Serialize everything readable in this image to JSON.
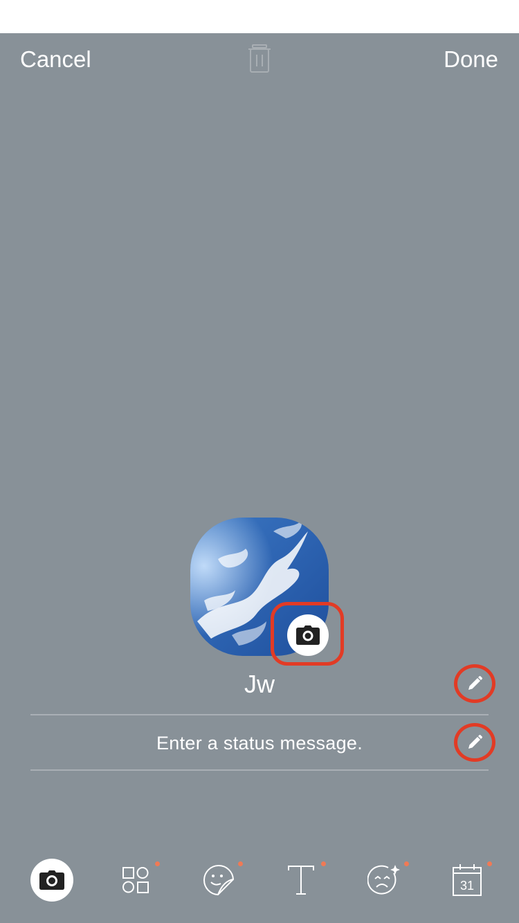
{
  "topbar": {
    "cancel_label": "Cancel",
    "done_label": "Done",
    "trash_icon": "trash-icon"
  },
  "profile": {
    "name": "Jw",
    "status_placeholder": "Enter a status message.",
    "avatar_description": "sky-with-clouds-photo"
  },
  "icons": {
    "camera_badge": "camera-icon",
    "edit_name": "pencil-icon",
    "edit_status": "pencil-icon"
  },
  "toolbar": {
    "items": [
      {
        "name": "camera",
        "icon": "camera-icon",
        "active": true,
        "has_dot": false
      },
      {
        "name": "shapes",
        "icon": "shapes-icon",
        "active": false,
        "has_dot": true
      },
      {
        "name": "sticker",
        "icon": "sticker-icon",
        "active": false,
        "has_dot": true
      },
      {
        "name": "text",
        "icon": "text-icon",
        "active": false,
        "has_dot": true
      },
      {
        "name": "effects",
        "icon": "sparkle-face-icon",
        "active": false,
        "has_dot": true
      },
      {
        "name": "calendar",
        "icon": "calendar-icon",
        "active": false,
        "has_dot": true,
        "label": "31"
      }
    ]
  },
  "colors": {
    "background": "#889198",
    "highlight": "#e23b25",
    "notification_dot": "#f07a55"
  }
}
